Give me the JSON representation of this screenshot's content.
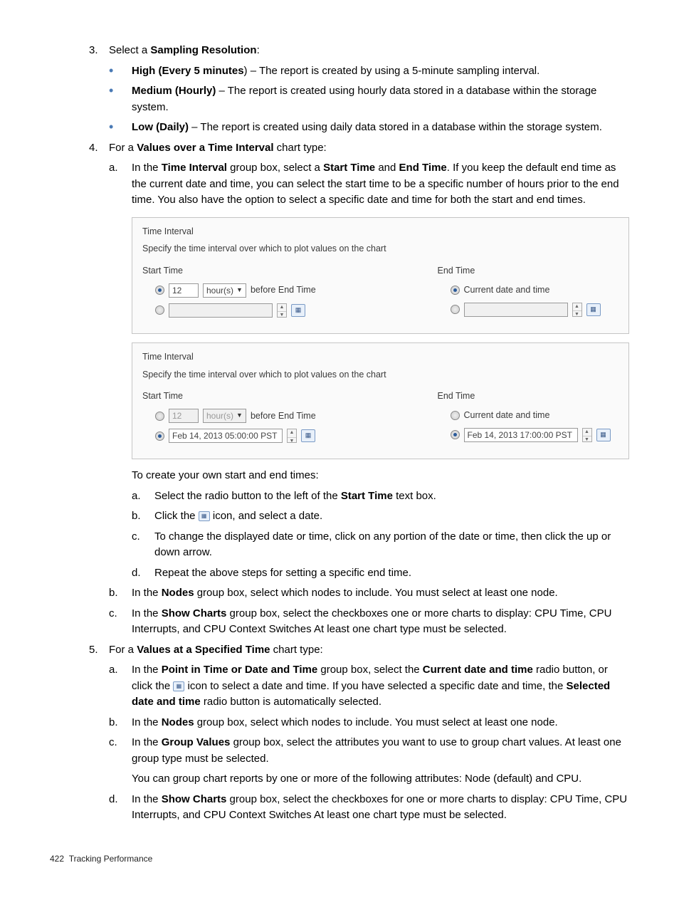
{
  "steps": {
    "s3": {
      "num": "3.",
      "lead": "Select a ",
      "bold1": "Sampling Resolution",
      "tail": ":",
      "high_b": "High (Every 5 minutes",
      "high_t": ") – The report is created by using a 5-minute sampling interval.",
      "med_b": "Medium (Hourly)",
      "med_t": " – The report is created using hourly data stored in a database within the storage system.",
      "low_b": "Low (Daily)",
      "low_t": " – The report is created using daily data stored in a database within the storage system."
    },
    "s4": {
      "num": "4.",
      "lead": "For a ",
      "bold1": "Values over a Time Interval",
      "tail": " chart type:",
      "a": {
        "let": "a.",
        "p1": "In the ",
        "b1": "Time Interval",
        "p2": " group box, select a ",
        "b2": "Start Time",
        "p3": " and ",
        "b3": "End Time",
        "p4": ". If you keep the default end time as the current date and time, you can select the start time to be a specific number of hours prior to the end time. You also have the option to select a specific date and time for both the start and end times."
      },
      "own": "To create your own start and end times:",
      "sa": {
        "let": "a.",
        "p1": "Select the radio button to the left of the ",
        "b1": "Start Time",
        "p2": " text box."
      },
      "sb": {
        "let": "b.",
        "p1": "Click the ",
        "p2": " icon, and select a date."
      },
      "sc": {
        "let": "c.",
        "txt": "To change the displayed date or time, click on any portion of the date or time, then click the up or down arrow."
      },
      "sd": {
        "let": "d.",
        "txt": "Repeat the above steps for setting a specific end time."
      },
      "bb": {
        "let": "b.",
        "p1": "In the ",
        "b1": "Nodes",
        "p2": " group box, select which nodes to include. You must select at least one node."
      },
      "bc": {
        "let": "c.",
        "p1": "In the ",
        "b1": "Show Charts",
        "p2": " group box, select the checkboxes one or more charts to display: CPU Time, CPU Interrupts, and CPU Context Switches At least one chart type must be selected."
      }
    },
    "s5": {
      "num": "5.",
      "lead": "For a ",
      "bold1": "Values at a Specified Time",
      "tail": " chart type:",
      "a": {
        "let": "a.",
        "p1": "In the ",
        "b1": "Point in Time or Date and Time",
        "p2": " group box, select the ",
        "b2": "Current date and time",
        "p3": " radio button, or click the ",
        "p4": " icon to select a date and time. If you have selected a specific date and time, the ",
        "b3": "Selected date and time",
        "p5": " radio button is automatically selected."
      },
      "b": {
        "let": "b.",
        "p1": "In the ",
        "b1": "Nodes",
        "p2": " group box, select which nodes to include. You must select at least one node."
      },
      "c": {
        "let": "c.",
        "p1": "In the ",
        "b1": "Group Values",
        "p2": " group box, select the attributes you want to use to group chart values. At least one group type must be selected.",
        "p3": "You can group chart reports by one or more of the following attributes: Node (default) and CPU."
      },
      "d": {
        "let": "d.",
        "p1": "In the ",
        "b1": "Show Charts",
        "p2": " group box, select the checkboxes for one or more charts to display: CPU Time, CPU Interrupts, and CPU Context Switches At least one chart type must be selected."
      }
    }
  },
  "panel": {
    "title": "Time Interval",
    "desc": "Specify the time interval over which to plot values on the chart",
    "start": "Start Time",
    "end": "End Time",
    "twelve": "12",
    "hours": "hour(s)",
    "before": "before End Time",
    "current": "Current date and time",
    "date1": "Feb 14, 2013 05:00:00 PST",
    "date2": "Feb 14, 2013 17:00:00 PST"
  },
  "footer": {
    "page": "422",
    "label": "Tracking Performance"
  }
}
